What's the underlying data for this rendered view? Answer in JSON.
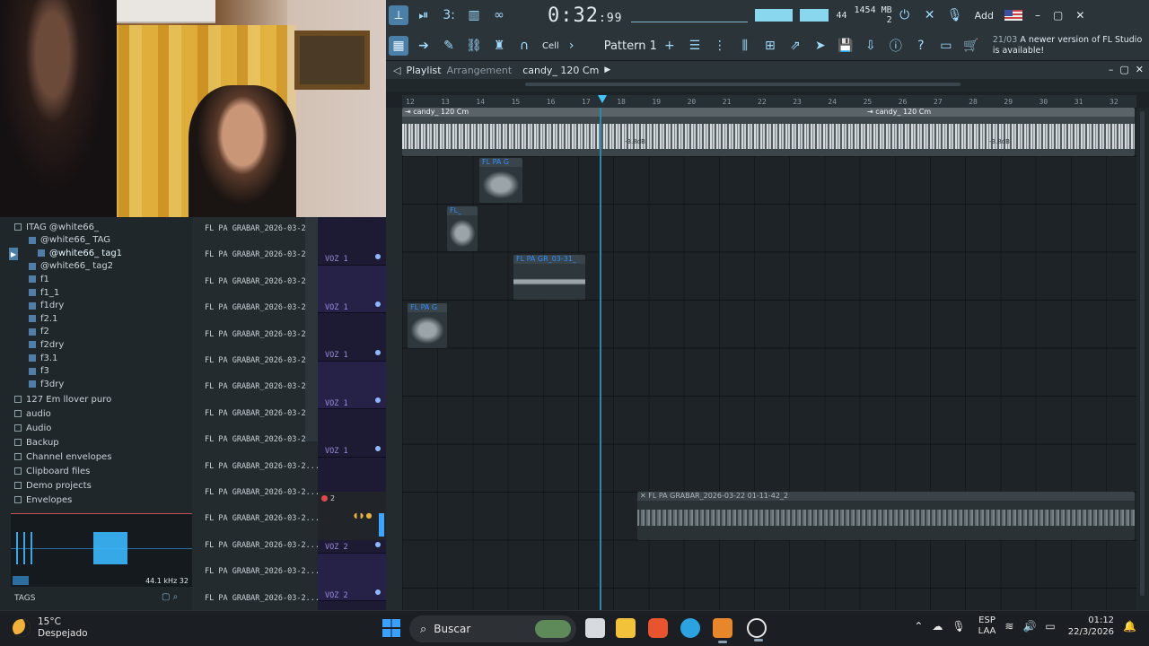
{
  "topbar": {
    "time_main": "0:32",
    "time_sub": "99",
    "time_unit_label": "M:S:CS",
    "cpu_value": "44",
    "memory": "1454 MB",
    "polyphony": "2",
    "add_label": "Add",
    "snap_label": "Cell",
    "pattern_label": "Pattern 1",
    "update_date": "21/03",
    "update_text": "A newer version of FL Studio is available!"
  },
  "playlist": {
    "title": "Playlist",
    "subtitle": "Arrangement",
    "arrangement_name": "candy_ 120 Cm",
    "ruler_ticks": [
      "12",
      "13",
      "14",
      "15",
      "16",
      "17",
      "18",
      "19",
      "20",
      "21",
      "22",
      "23",
      "24",
      "25",
      "26",
      "27",
      "28",
      "29",
      "30",
      "31",
      "32"
    ],
    "main_clip_label": "candy_ 120 Cm",
    "main_clip_label2": "candy_ 120 Cm",
    "db_marks": [
      "-3.8dB",
      "-3.8dB"
    ],
    "small_clips": [
      "FL PA G",
      "FL_",
      "FL PA GR_03-31_",
      "FL PA G"
    ],
    "voz2_clip_label": "FL PA GRABAR_2026-03-22 01-11-42_2"
  },
  "browser": {
    "items": [
      {
        "label": "ITAG @white66_",
        "indent": 0
      },
      {
        "label": "@white66_ TAG",
        "indent": 1
      },
      {
        "label": "@white66_ tag1",
        "indent": 2
      },
      {
        "label": "@white66_ tag2",
        "indent": 1
      },
      {
        "label": "f1",
        "indent": 1
      },
      {
        "label": "f1_1",
        "indent": 1
      },
      {
        "label": "f1dry",
        "indent": 1
      },
      {
        "label": "f2.1",
        "indent": 1
      },
      {
        "label": "f2",
        "indent": 1
      },
      {
        "label": "f2dry",
        "indent": 1
      },
      {
        "label": "f3.1",
        "indent": 1
      },
      {
        "label": "f3",
        "indent": 1
      },
      {
        "label": "f3dry",
        "indent": 1
      },
      {
        "label": "127 Em llover puro",
        "indent": 0
      },
      {
        "label": "audio",
        "indent": 0
      },
      {
        "label": "Audio",
        "indent": 0
      },
      {
        "label": "Backup",
        "indent": 0
      },
      {
        "label": "Channel envelopes",
        "indent": 0
      },
      {
        "label": "Clipboard files",
        "indent": 0
      },
      {
        "label": "Demo projects",
        "indent": 0
      },
      {
        "label": "Envelopes",
        "indent": 0
      }
    ],
    "preview_info": "44.1 kHz 32",
    "tags_label": "TAGS"
  },
  "channels": {
    "names": [
      "FL PA GRABAR_2026-03-2...",
      "FL PA GRABAR_2026-03-2...",
      "FL PA GRABAR_2026-03-2...",
      "FL PA GRABAR_2026-03-2...",
      "FL PA GRABAR_2026-03-2...",
      "FL PA GRABAR_2026-03-2...",
      "FL PA GRABAR_2026-03-2...",
      "FL PA GRABAR_2026-03-2...",
      "FL PA GRABAR_2026-03-2...",
      "FL PA GRABAR_2026-03-2...",
      "FL PA GRABAR_2026-03-2...",
      "FL PA GRABAR_2026-03-2...",
      "FL PA GRABAR_2026-03-2...",
      "FL PA GRABAR_2026-03-2...",
      "FL PA GRABAR_2026-03-2..."
    ]
  },
  "tracks": {
    "labels": [
      "VOZ 1",
      "VOZ 1",
      "VOZ 1",
      "VOZ 1",
      "VOZ 1",
      "2",
      "VOZ 2",
      "VOZ 2"
    ]
  },
  "taskbar": {
    "temperature": "15°C",
    "weather": "Despejado",
    "search_placeholder": "Buscar",
    "lang_top": "ESP",
    "lang_bottom": "LAA",
    "time": "01:12",
    "date": "22/3/2026"
  }
}
